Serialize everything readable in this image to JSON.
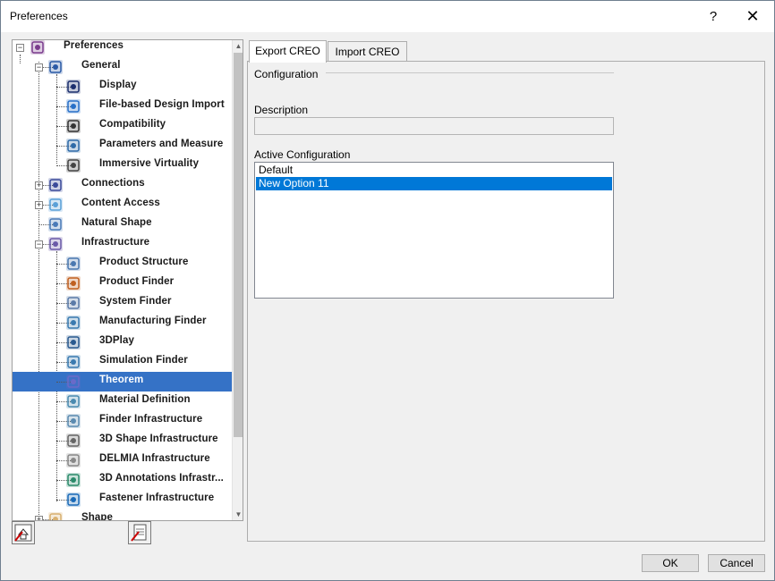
{
  "window": {
    "title": "Preferences",
    "help_label": "?",
    "close_label": "✕"
  },
  "tree": {
    "items": [
      {
        "label": "Preferences",
        "icon": "preferences-icon"
      },
      {
        "label": "General",
        "icon": "general-icon"
      },
      {
        "label": "Display",
        "icon": "display-icon"
      },
      {
        "label": "File-based Design Import",
        "icon": "file-import-icon"
      },
      {
        "label": "Compatibility",
        "icon": "compatibility-icon"
      },
      {
        "label": "Parameters and Measure",
        "icon": "parameters-icon"
      },
      {
        "label": "Immersive Virtuality",
        "icon": "hand-icon"
      },
      {
        "label": "Connections",
        "icon": "connections-icon"
      },
      {
        "label": "Content Access",
        "icon": "content-access-icon"
      },
      {
        "label": "Natural Shape",
        "icon": "natural-shape-icon"
      },
      {
        "label": "Infrastructure",
        "icon": "infrastructure-icon"
      },
      {
        "label": "Product Structure",
        "icon": "product-structure-icon"
      },
      {
        "label": "Product Finder",
        "icon": "product-finder-icon"
      },
      {
        "label": "System Finder",
        "icon": "system-finder-icon"
      },
      {
        "label": "Manufacturing Finder",
        "icon": "manufacturing-finder-icon"
      },
      {
        "label": "3DPlay",
        "icon": "play-icon"
      },
      {
        "label": "Simulation Finder",
        "icon": "simulation-finder-icon"
      },
      {
        "label": "Theorem",
        "icon": "theorem-icon"
      },
      {
        "label": "Material Definition",
        "icon": "material-icon"
      },
      {
        "label": "Finder Infrastructure",
        "icon": "finder-infrastructure-icon"
      },
      {
        "label": "3D Shape Infrastructure",
        "icon": "gear-icon"
      },
      {
        "label": "DELMIA Infrastructure",
        "icon": "delmia-icon"
      },
      {
        "label": "3D Annotations Infrastr...",
        "icon": "annotation-icon"
      },
      {
        "label": "Fastener Infrastructure",
        "icon": "fastener-icon"
      },
      {
        "label": "Shape",
        "icon": "shape-icon"
      }
    ]
  },
  "tabs": [
    {
      "label": "Export CREO"
    },
    {
      "label": "Import CREO"
    }
  ],
  "panel": {
    "configuration_label": "Configuration",
    "description_label": "Description",
    "description_value": "",
    "active_configuration_label": "Active Configuration",
    "configurations": [
      "Default",
      "New Option 11"
    ]
  },
  "buttons": {
    "ok": "OK",
    "cancel": "Cancel"
  },
  "colors": {
    "tree_selection": "#3572c6",
    "list_selection": "#0078d7"
  }
}
